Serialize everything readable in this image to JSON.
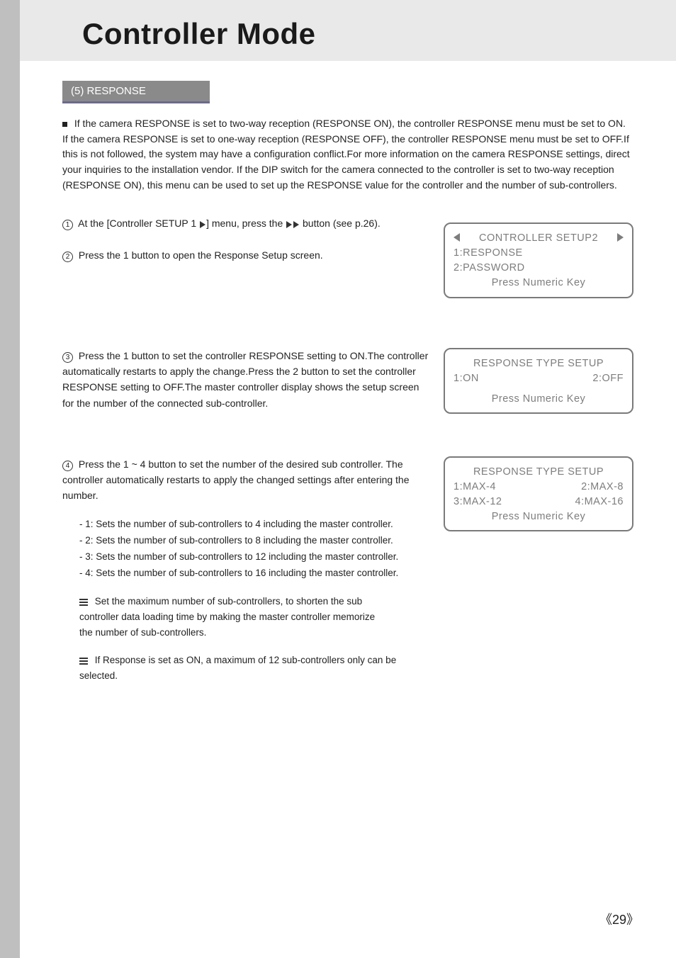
{
  "title": "Controller Mode",
  "section_label": "(5) RESPONSE",
  "intro": "If the camera RESPONSE is set to two-way reception (RESPONSE ON), the controller RESPONSE menu must be set to ON. If the camera RESPONSE is set to one-way reception (RESPONSE OFF), the controller RESPONSE menu must be set to OFF.If this is not followed, the system may have a configuration conflict.For more information on the camera RESPONSE settings, direct your inquiries to the installation vendor. If the DIP switch for the camera connected to the controller is set to two-way reception (RESPONSE ON), this menu can be used to set up the RESPONSE value for the controller and the number of sub-controllers.",
  "steps": {
    "s1_a": "At the [Controller SETUP 1 ",
    "s1_b": "] menu, press the ",
    "s1_c": " button (see p.26).",
    "s2": "Press the 1 button to open the Response Setup screen.",
    "s3": "Press the 1 button to set the controller RESPONSE setting to ON.The controller automatically restarts to apply the change.Press the 2 button to set the controller RESPONSE setting to OFF.The master controller display shows the setup screen for the number of the connected sub-controller.",
    "s4": "Press the 1 ~ 4 button to set the number of the desired sub controller. The controller automatically restarts to apply the changed settings after entering the number."
  },
  "sublist": [
    "- 1: Sets the number of sub-controllers to 4 including the master controller.",
    "- 2: Sets the number of sub-controllers to 8 including the master controller.",
    "- 3: Sets the number of sub-controllers to 12 including the master controller.",
    "- 4: Sets the number of sub-controllers to 16 including the master controller."
  ],
  "notes": [
    "Set the maximum number of sub-controllers, to shorten the sub controller data loading time by making the master controller memorize the number of sub-controllers.",
    "If Response is set as ON, a maximum of 12 sub-controllers only can be selected."
  ],
  "lcd1": {
    "head": "CONTROLLER SETUP2",
    "l1": "1:RESPONSE",
    "l2": "2:PASSWORD",
    "foot": "Press Numeric Key"
  },
  "lcd2": {
    "head": "RESPONSE TYPE SETUP",
    "left": "1:ON",
    "right": "2:OFF",
    "foot": "Press Numeric Key"
  },
  "lcd3": {
    "head": "RESPONSE TYPE SETUP",
    "r1l": "1:MAX-4",
    "r1r": "2:MAX-8",
    "r2l": "3:MAX-12",
    "r2r": "4:MAX-16",
    "foot": "Press Numeric Key"
  },
  "page_number": "29"
}
